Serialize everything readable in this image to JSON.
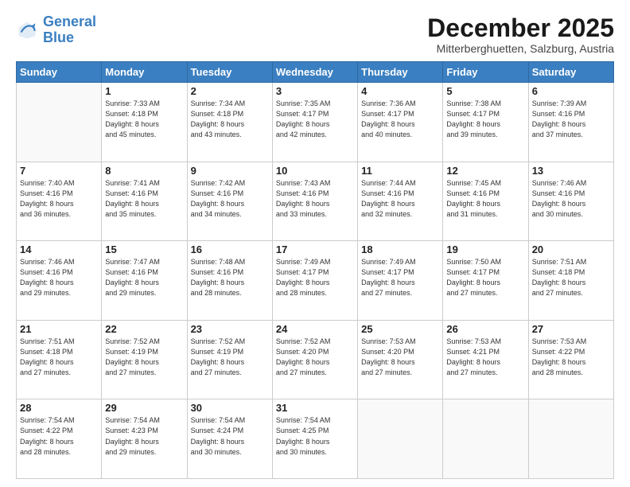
{
  "logo": {
    "line1": "General",
    "line2": "Blue"
  },
  "title": "December 2025",
  "subtitle": "Mitterberghuetten, Salzburg, Austria",
  "headers": [
    "Sunday",
    "Monday",
    "Tuesday",
    "Wednesday",
    "Thursday",
    "Friday",
    "Saturday"
  ],
  "weeks": [
    [
      {
        "day": "",
        "info": ""
      },
      {
        "day": "1",
        "info": "Sunrise: 7:33 AM\nSunset: 4:18 PM\nDaylight: 8 hours\nand 45 minutes."
      },
      {
        "day": "2",
        "info": "Sunrise: 7:34 AM\nSunset: 4:18 PM\nDaylight: 8 hours\nand 43 minutes."
      },
      {
        "day": "3",
        "info": "Sunrise: 7:35 AM\nSunset: 4:17 PM\nDaylight: 8 hours\nand 42 minutes."
      },
      {
        "day": "4",
        "info": "Sunrise: 7:36 AM\nSunset: 4:17 PM\nDaylight: 8 hours\nand 40 minutes."
      },
      {
        "day": "5",
        "info": "Sunrise: 7:38 AM\nSunset: 4:17 PM\nDaylight: 8 hours\nand 39 minutes."
      },
      {
        "day": "6",
        "info": "Sunrise: 7:39 AM\nSunset: 4:16 PM\nDaylight: 8 hours\nand 37 minutes."
      }
    ],
    [
      {
        "day": "7",
        "info": "Sunrise: 7:40 AM\nSunset: 4:16 PM\nDaylight: 8 hours\nand 36 minutes."
      },
      {
        "day": "8",
        "info": "Sunrise: 7:41 AM\nSunset: 4:16 PM\nDaylight: 8 hours\nand 35 minutes."
      },
      {
        "day": "9",
        "info": "Sunrise: 7:42 AM\nSunset: 4:16 PM\nDaylight: 8 hours\nand 34 minutes."
      },
      {
        "day": "10",
        "info": "Sunrise: 7:43 AM\nSunset: 4:16 PM\nDaylight: 8 hours\nand 33 minutes."
      },
      {
        "day": "11",
        "info": "Sunrise: 7:44 AM\nSunset: 4:16 PM\nDaylight: 8 hours\nand 32 minutes."
      },
      {
        "day": "12",
        "info": "Sunrise: 7:45 AM\nSunset: 4:16 PM\nDaylight: 8 hours\nand 31 minutes."
      },
      {
        "day": "13",
        "info": "Sunrise: 7:46 AM\nSunset: 4:16 PM\nDaylight: 8 hours\nand 30 minutes."
      }
    ],
    [
      {
        "day": "14",
        "info": "Sunrise: 7:46 AM\nSunset: 4:16 PM\nDaylight: 8 hours\nand 29 minutes."
      },
      {
        "day": "15",
        "info": "Sunrise: 7:47 AM\nSunset: 4:16 PM\nDaylight: 8 hours\nand 29 minutes."
      },
      {
        "day": "16",
        "info": "Sunrise: 7:48 AM\nSunset: 4:16 PM\nDaylight: 8 hours\nand 28 minutes."
      },
      {
        "day": "17",
        "info": "Sunrise: 7:49 AM\nSunset: 4:17 PM\nDaylight: 8 hours\nand 28 minutes."
      },
      {
        "day": "18",
        "info": "Sunrise: 7:49 AM\nSunset: 4:17 PM\nDaylight: 8 hours\nand 27 minutes."
      },
      {
        "day": "19",
        "info": "Sunrise: 7:50 AM\nSunset: 4:17 PM\nDaylight: 8 hours\nand 27 minutes."
      },
      {
        "day": "20",
        "info": "Sunrise: 7:51 AM\nSunset: 4:18 PM\nDaylight: 8 hours\nand 27 minutes."
      }
    ],
    [
      {
        "day": "21",
        "info": "Sunrise: 7:51 AM\nSunset: 4:18 PM\nDaylight: 8 hours\nand 27 minutes."
      },
      {
        "day": "22",
        "info": "Sunrise: 7:52 AM\nSunset: 4:19 PM\nDaylight: 8 hours\nand 27 minutes."
      },
      {
        "day": "23",
        "info": "Sunrise: 7:52 AM\nSunset: 4:19 PM\nDaylight: 8 hours\nand 27 minutes."
      },
      {
        "day": "24",
        "info": "Sunrise: 7:52 AM\nSunset: 4:20 PM\nDaylight: 8 hours\nand 27 minutes."
      },
      {
        "day": "25",
        "info": "Sunrise: 7:53 AM\nSunset: 4:20 PM\nDaylight: 8 hours\nand 27 minutes."
      },
      {
        "day": "26",
        "info": "Sunrise: 7:53 AM\nSunset: 4:21 PM\nDaylight: 8 hours\nand 27 minutes."
      },
      {
        "day": "27",
        "info": "Sunrise: 7:53 AM\nSunset: 4:22 PM\nDaylight: 8 hours\nand 28 minutes."
      }
    ],
    [
      {
        "day": "28",
        "info": "Sunrise: 7:54 AM\nSunset: 4:22 PM\nDaylight: 8 hours\nand 28 minutes."
      },
      {
        "day": "29",
        "info": "Sunrise: 7:54 AM\nSunset: 4:23 PM\nDaylight: 8 hours\nand 29 minutes."
      },
      {
        "day": "30",
        "info": "Sunrise: 7:54 AM\nSunset: 4:24 PM\nDaylight: 8 hours\nand 30 minutes."
      },
      {
        "day": "31",
        "info": "Sunrise: 7:54 AM\nSunset: 4:25 PM\nDaylight: 8 hours\nand 30 minutes."
      },
      {
        "day": "",
        "info": ""
      },
      {
        "day": "",
        "info": ""
      },
      {
        "day": "",
        "info": ""
      }
    ]
  ]
}
